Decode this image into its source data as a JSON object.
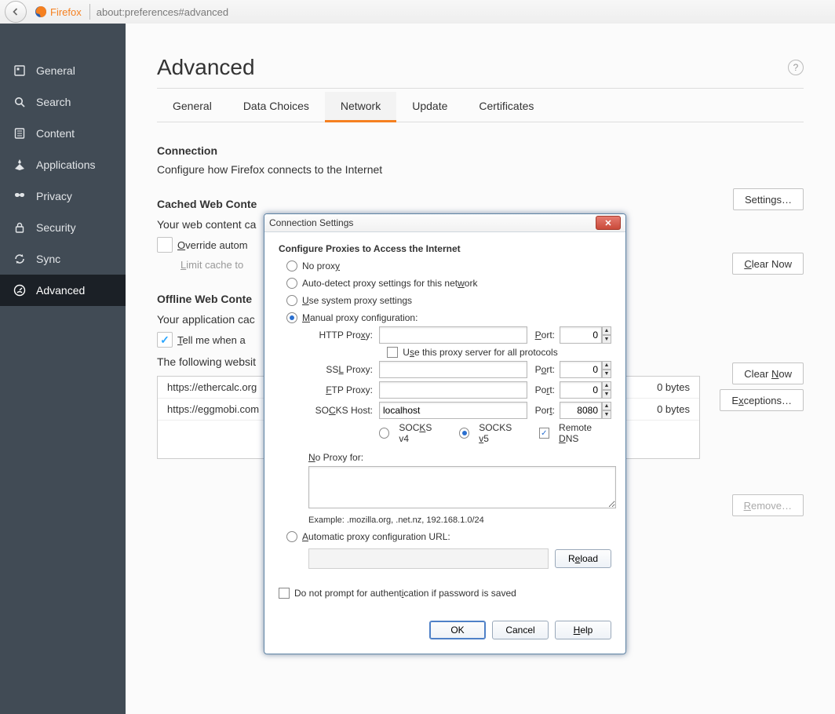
{
  "urlbar": {
    "firefox_label": "Firefox",
    "address": "about:preferences#advanced"
  },
  "sidebar": {
    "general": "General",
    "search": "Search",
    "content": "Content",
    "applications": "Applications",
    "privacy": "Privacy",
    "security": "Security",
    "sync": "Sync",
    "advanced": "Advanced"
  },
  "page": {
    "title": "Advanced",
    "tabs": {
      "general": "General",
      "data_choices": "Data Choices",
      "network": "Network",
      "update": "Update",
      "certificates": "Certificates"
    }
  },
  "connection": {
    "title": "Connection",
    "sub": "Configure how Firefox connects to the Internet",
    "settings_btn": "Settings…"
  },
  "cached": {
    "title": "Cached Web Content",
    "sub": "Your web content cache",
    "clear_btn": "Clear Now",
    "override_label": "Override automatic cache management",
    "limit_label": "Limit cache to"
  },
  "offline": {
    "title": "Offline Web Content and User Data",
    "sub": "Your application cache",
    "clear_btn": "Clear Now",
    "tellme_label": "Tell me when a website asks to store data for offline use",
    "exceptions_btn": "Exceptions…",
    "following_label": "The following websites are allowed to store data for offline use:",
    "sites": [
      {
        "url": "https://ethercalc.org",
        "size": "0 bytes"
      },
      {
        "url": "https://eggmobi.com",
        "size": "0 bytes"
      }
    ],
    "remove_btn": "Remove…"
  },
  "dialog": {
    "title": "Connection Settings",
    "heading": "Configure Proxies to Access the Internet",
    "opt_no": "No proxy",
    "opt_auto": "Auto-detect proxy settings for this network",
    "opt_sys": "Use system proxy settings",
    "opt_manual": "Manual proxy configuration:",
    "http_lbl": "HTTP Proxy:",
    "ssl_lbl": "SSL Proxy:",
    "ftp_lbl": "FTP Proxy:",
    "socks_lbl": "SOCKS Host:",
    "port_lbl": "Port:",
    "http_val": "",
    "http_port": "0",
    "ssl_val": "",
    "ssl_port": "0",
    "ftp_val": "",
    "ftp_port": "0",
    "socks_val": "localhost",
    "socks_port": "8080",
    "use_all": "Use this proxy server for all protocols",
    "socks4": "SOCKS v4",
    "socks5": "SOCKS v5",
    "remote_dns": "Remote DNS",
    "noproxy_lbl": "No Proxy for:",
    "example": "Example: .mozilla.org, .net.nz, 192.168.1.0/24",
    "opt_pac": "Automatic proxy configuration URL:",
    "reload_btn": "Reload",
    "noprompt": "Do not prompt for authentication if password is saved",
    "ok": "OK",
    "cancel": "Cancel",
    "help": "Help"
  }
}
